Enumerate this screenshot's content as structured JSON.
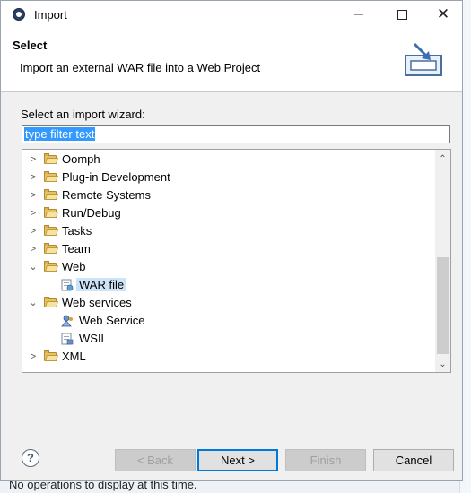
{
  "window": {
    "title": "Import",
    "minimize_glyph": "minimize",
    "maximize_glyph": "maximize",
    "close_glyph": "✕"
  },
  "header": {
    "title": "Select",
    "description": "Import an external WAR file into a Web Project"
  },
  "filter": {
    "label": "Select an import wizard:",
    "value": "type filter text"
  },
  "tree": {
    "items": [
      {
        "label": "Oomph",
        "icon": "folder-icon",
        "expanded": false
      },
      {
        "label": "Plug-in Development",
        "icon": "folder-icon",
        "expanded": false
      },
      {
        "label": "Remote Systems",
        "icon": "folder-icon",
        "expanded": false
      },
      {
        "label": "Run/Debug",
        "icon": "folder-icon",
        "expanded": false
      },
      {
        "label": "Tasks",
        "icon": "folder-icon",
        "expanded": false
      },
      {
        "label": "Team",
        "icon": "folder-icon",
        "expanded": false
      },
      {
        "label": "Web",
        "icon": "folder-icon",
        "expanded": true
      },
      {
        "label": "WAR file",
        "icon": "war-file-icon",
        "selected": true
      },
      {
        "label": "Web services",
        "icon": "folder-icon",
        "expanded": true
      },
      {
        "label": "Web Service",
        "icon": "web-service-icon"
      },
      {
        "label": "WSIL",
        "icon": "wsil-icon"
      },
      {
        "label": "XML",
        "icon": "folder-icon",
        "expanded": false
      }
    ]
  },
  "buttons": {
    "help": "?",
    "back": "< Back",
    "next": "Next >",
    "finish": "Finish",
    "cancel": "Cancel"
  },
  "background": {
    "status_text": "No operations to display at this time."
  },
  "colors": {
    "selection": "#cde3f7",
    "filter_highlight": "#3399ff",
    "default_button_border": "#0078d7"
  }
}
